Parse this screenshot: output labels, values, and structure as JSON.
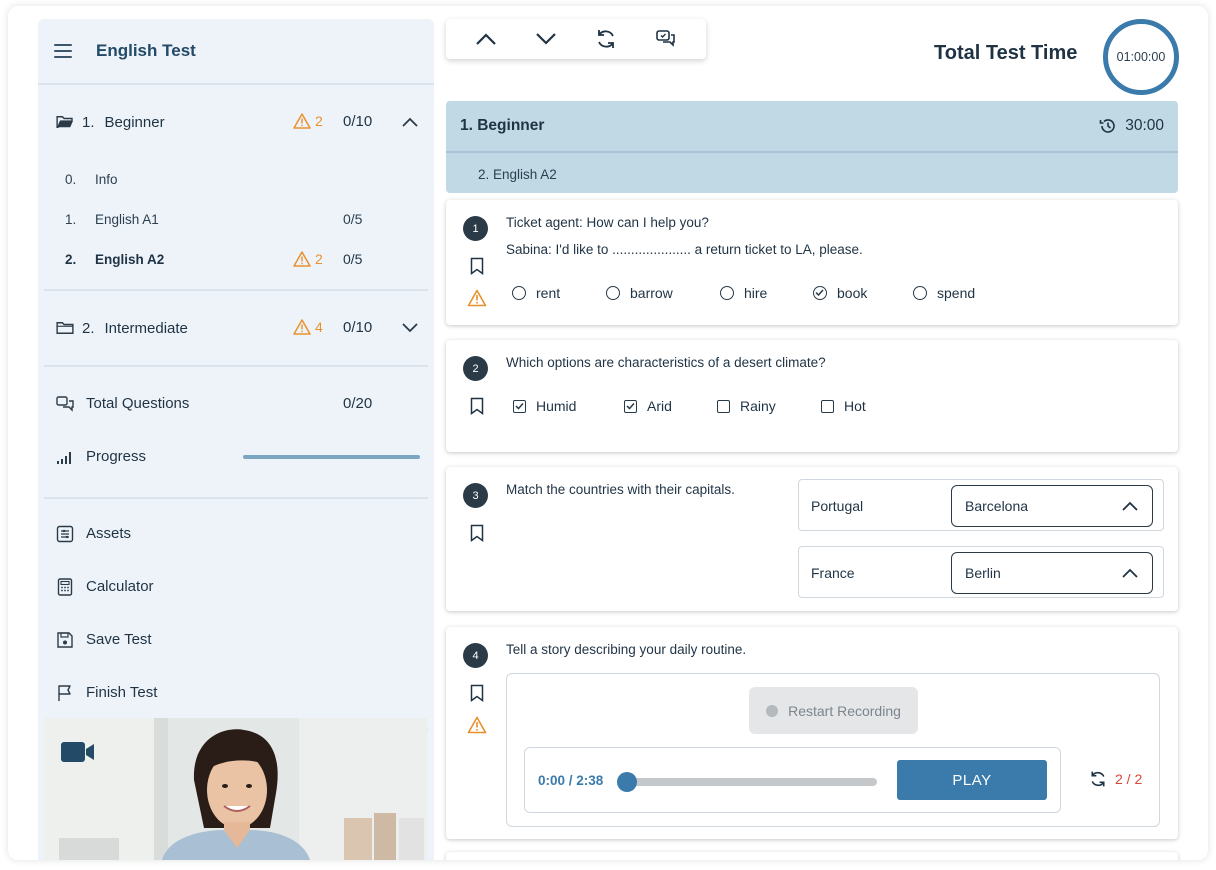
{
  "sidebar": {
    "title": "English Test",
    "sections": [
      {
        "number": "1.",
        "label": "Beginner",
        "warnings": "2",
        "score": "0/10",
        "expanded": true,
        "items": [
          {
            "number": "0.",
            "label": "Info",
            "score": "",
            "warnings": ""
          },
          {
            "number": "1.",
            "label": "English A1",
            "score": "0/5",
            "warnings": ""
          },
          {
            "number": "2.",
            "label": "English A2",
            "score": "0/5",
            "warnings": "2"
          }
        ]
      },
      {
        "number": "2.",
        "label": "Intermediate",
        "warnings": "4",
        "score": "0/10",
        "expanded": false
      }
    ],
    "stats": {
      "total_questions_label": "Total Questions",
      "total_questions_value": "0/20",
      "progress_label": "Progress",
      "progress_fraction": 0
    },
    "tools": {
      "assets": "Assets",
      "calculator": "Calculator",
      "save": "Save Test",
      "finish": "Finish Test"
    }
  },
  "header": {
    "total_time_label": "Total Test Time",
    "total_time_value": "01:00:00"
  },
  "section_header": {
    "title": "1. Beginner",
    "time": "30:00",
    "subsection": "2. English A2"
  },
  "questions": [
    {
      "number": "1",
      "line1": "Ticket agent: How can I help you?",
      "line2": "Sabina: I'd like to ..................... a return ticket to LA, please.",
      "options": [
        "rent",
        "barrow",
        "hire",
        "book",
        "spend"
      ],
      "selected": "book"
    },
    {
      "number": "2",
      "text": "Which options are characteristics of a desert climate?",
      "options": [
        "Humid",
        "Arid",
        "Rainy",
        "Hot"
      ],
      "checked": [
        "Humid",
        "Arid"
      ]
    },
    {
      "number": "3",
      "text": "Match the countries with their capitals.",
      "pairs": [
        {
          "country": "Portugal",
          "capital": "Barcelona"
        },
        {
          "country": "France",
          "capital": "Berlin"
        }
      ]
    },
    {
      "number": "4",
      "text": "Tell a story describing your daily routine.",
      "restart_label": "Restart Recording",
      "time_display": "0:00 / 2:38",
      "play_label": "PLAY",
      "retries": "2 / 2"
    }
  ],
  "colors": {
    "accent": "#3b7bab",
    "warning": "#e8912c",
    "sidebar_bg": "#eef3f9",
    "section_header_bg": "#c1d8e5",
    "retries": "#d9453a"
  }
}
